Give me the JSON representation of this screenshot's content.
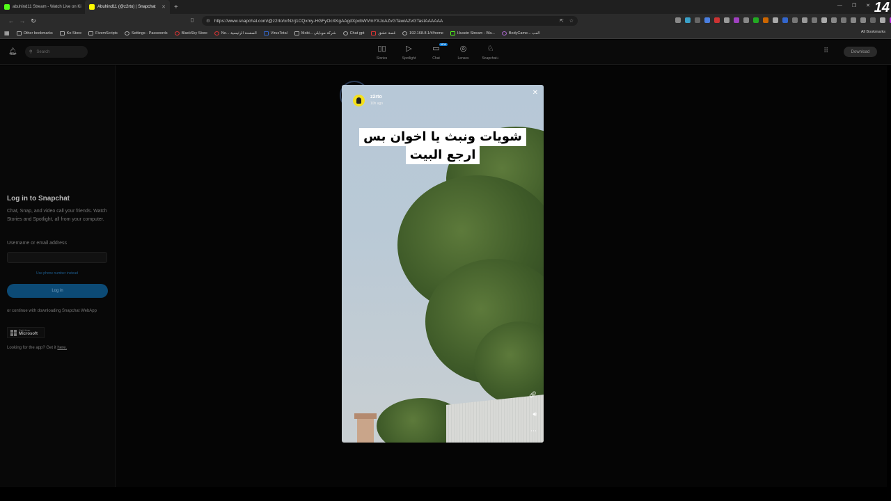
{
  "browser": {
    "tabs": [
      {
        "title": "abuhind11 Stream - Watch Live on Ki",
        "color": "#53fc18",
        "active": false
      },
      {
        "title": "Abuhind11 (@z2rto) | Snapchat",
        "color": "#fffc00",
        "active": true
      }
    ],
    "url": "https://www.snapchat.com/@z2rto/xrNzrj1CQxmy-HGFyOcXKgAAgdXpxbWVmYXJoAZvGTawiAZvGTastAAAAAA",
    "corner_number": "14",
    "bookmarks": [
      "Other bookmarks",
      "Ko Store",
      "FivemScripts",
      "Settings - Passwords",
      "BlackSky Store",
      "Ne... الصفحة الرئيسية",
      "VirusTotal",
      "Mobi... شركة موبايلي",
      "Chat gpt",
      "قصة عشق",
      "192.168.8.1/#/home",
      "Husein Stream - Wa...",
      "BodyCame... العب"
    ],
    "all_bookmarks": "All Bookmarks"
  },
  "snapchat": {
    "search_placeholder": "Search",
    "nav": [
      {
        "label": "Stories",
        "icon": "stories-icon",
        "glyph": "▯▯"
      },
      {
        "label": "Spotlight",
        "icon": "spotlight-icon",
        "glyph": "▷"
      },
      {
        "label": "Chat",
        "icon": "chat-icon",
        "glyph": "▭",
        "badge": "NEW"
      },
      {
        "label": "Lenses",
        "icon": "lenses-icon",
        "glyph": "◎"
      },
      {
        "label": "Snapchat+",
        "icon": "ghost-icon",
        "glyph": "♘"
      }
    ],
    "download_label": "Download"
  },
  "login": {
    "title": "Log in to Snapchat",
    "description": "Chat, Snap, and video call your friends. Watch Stories and Spotlight, all from your computer.",
    "field_label": "Username or email address",
    "phone_link": "Use phone number instead",
    "button_label": "Log in",
    "continue_text": "or continue with downloading Snapchat WebApp",
    "ms_small": "Get it from",
    "ms_big": "Microsoft",
    "looking_text": "Looking for the app? Get it ",
    "looking_link": "here."
  },
  "story": {
    "username": "z2rto",
    "time": "10h ago",
    "caption_line1": "شويات ونبث يا اخوان بس",
    "caption_line2": "ارجع البيت"
  },
  "colors": {
    "snap_yellow": "#f5e11d",
    "login_blue": "#0c4a75"
  }
}
